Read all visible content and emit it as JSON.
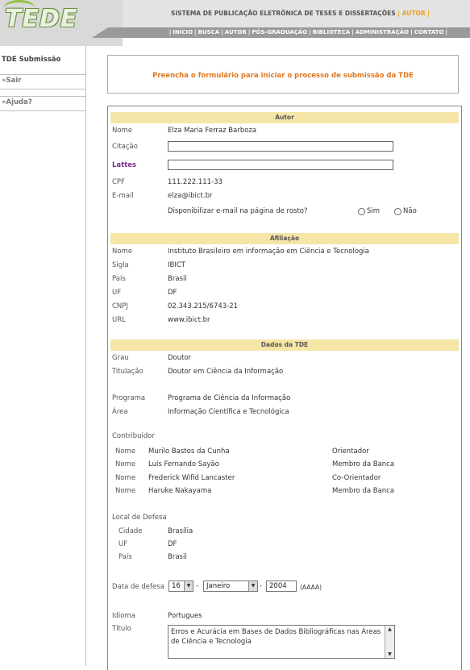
{
  "header": {
    "logo": "TEDE",
    "system_title": "SISTEMA DE PUBLICAÇÃO ELETRÔNICA DE TESES E DISSERTAÇÕES",
    "mode": "| AUTOR |",
    "nav": [
      "INÍCIO",
      "BUSCA",
      "AUTOR",
      "PÓS-GRADUAÇÃO",
      "BIBLIOTECA",
      "ADMINISTRAÇÃO",
      "CONTATO"
    ]
  },
  "sidebar": {
    "title": "TDE Submissão",
    "items": [
      "»Sair",
      "»Ajuda?"
    ]
  },
  "intro": "Preencha o formulário para iniciar o processo de submissão da TDE",
  "autor": {
    "heading": "Autor",
    "nome_label": "Nome",
    "nome": "Elza Maria Ferraz Barboza",
    "citacao_label": "Citação",
    "lattes_label": "Lattes",
    "cpf_label": "CPF",
    "cpf": "111.222.111-33",
    "email_label": "E-mail",
    "email": "elza@ibict.br",
    "disp_email": "Disponibilizar e-mail na página de rosto?",
    "sim": "Sim",
    "nao": "Não"
  },
  "afiliacao": {
    "heading": "Afiliação",
    "nome_label": "Nome",
    "nome": "Instituto Brasileiro em informação em Ciência e Tecnologia",
    "sigla_label": "Sigla",
    "sigla": "IBICT",
    "pais_label": "País",
    "pais": "Brasil",
    "uf_label": "UF",
    "uf": "DF",
    "cnpj_label": "CNPJ",
    "cnpj": "02.343.215/6743-21",
    "url_label": "URL",
    "url": "www.ibict.br"
  },
  "dados": {
    "heading": "Dados da TDE",
    "grau_label": "Grau",
    "grau": "Doutor",
    "titulacao_label": "Titulação",
    "titulacao": "Doutor em Ciência da Informação",
    "programa_label": "Programa",
    "programa": "Programa de Ciência da Informação",
    "area_label": "Área",
    "area": "Informação Científica e Tecnológica",
    "contrib_label": "Contribuidor",
    "contributors": [
      {
        "label": "Nome",
        "name": "Murilo Bastos da Cunha",
        "role": "Orientador"
      },
      {
        "label": "Nome",
        "name": "Luís Fernando Sayão",
        "role": "Membro da Banca"
      },
      {
        "label": "Nome",
        "name": "Frederick Wifid Lancaster",
        "role": "Co-Orientador"
      },
      {
        "label": "Nome",
        "name": "Haruke Nakayama",
        "role": "Membro da Banca"
      }
    ],
    "local_label": "Local de Defesa",
    "cidade_label": "Cidade",
    "cidade": "Brasília",
    "uf_label": "UF",
    "uf": "DF",
    "pais_label": "País",
    "pais": "Brasil",
    "data_label": "Data de defesa",
    "dia": "16",
    "mes": "Janeiro",
    "ano": "2004",
    "ano_hint": "(AAAA)",
    "dash": "-",
    "idioma_label": "Idioma",
    "idioma": "Portugues",
    "titulo_label": "Título",
    "titulo": "Erros e Acurácia em Bases de Dados Bibliográficas nas Áreas de Ciência e Tecnologia"
  }
}
